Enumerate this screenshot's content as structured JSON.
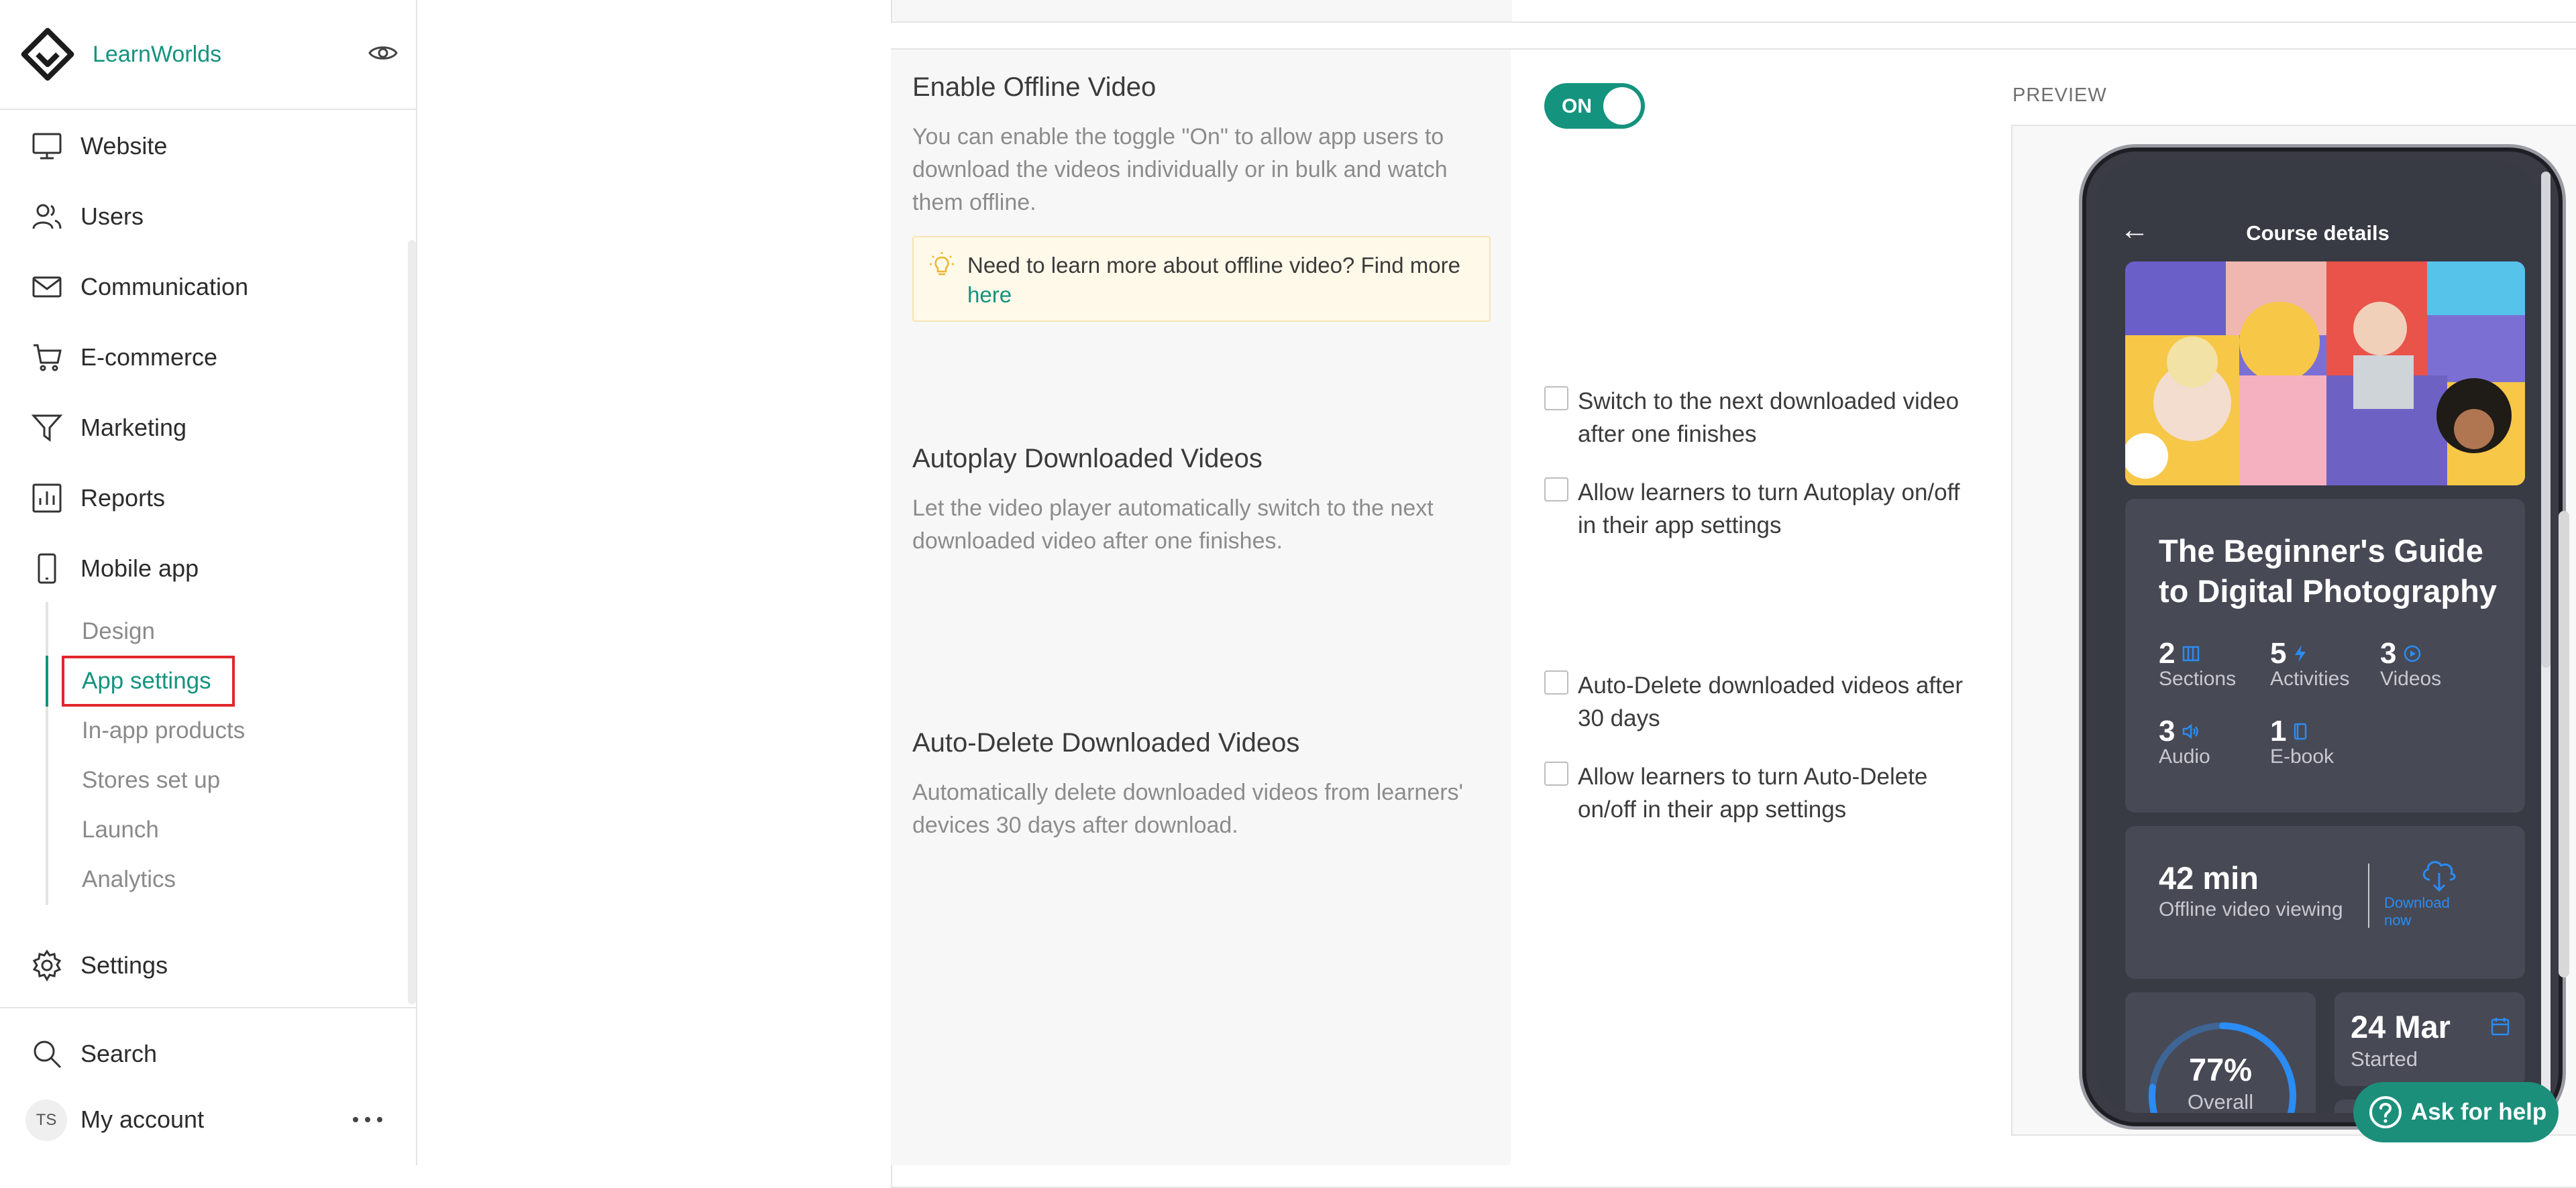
{
  "brand": {
    "name": "LearnWorlds"
  },
  "sidebar": {
    "items": [
      {
        "label": "Website",
        "icon": "monitor-icon"
      },
      {
        "label": "Users",
        "icon": "users-icon"
      },
      {
        "label": "Communication",
        "icon": "envelope-icon"
      },
      {
        "label": "E-commerce",
        "icon": "cart-icon"
      },
      {
        "label": "Marketing",
        "icon": "funnel-icon"
      },
      {
        "label": "Reports",
        "icon": "bar-chart-icon"
      },
      {
        "label": "Mobile app",
        "icon": "smartphone-icon"
      }
    ],
    "mobile_sub": [
      {
        "label": "Design"
      },
      {
        "label": "App settings",
        "active": true
      },
      {
        "label": "In-app products"
      },
      {
        "label": "Stores set up"
      },
      {
        "label": "Launch"
      },
      {
        "label": "Analytics"
      }
    ],
    "settings": "Settings",
    "search": "Search",
    "account": {
      "initials": "TS",
      "label": "My account"
    }
  },
  "offline": {
    "title": "Enable Offline Video",
    "description": "You can enable the toggle \"On\" to allow app users to download the videos individually or in bulk and watch them offline.",
    "tip": "Need to learn more about offline video? Find more",
    "tip_link": "here",
    "toggle_label": "ON",
    "toggle_on": true
  },
  "autoplay": {
    "title": "Autoplay Downloaded Videos",
    "description": "Let the video player automatically switch to the next downloaded video after one finishes.",
    "options": [
      {
        "label": "Switch to the next downloaded video after one finishes",
        "checked": false
      },
      {
        "label": "Allow learners to turn Autoplay on/off in their app settings",
        "checked": false
      }
    ]
  },
  "autodelete": {
    "title": "Auto-Delete Downloaded Videos",
    "description": "Automatically delete downloaded videos from learners' devices 30 days after download.",
    "options": [
      {
        "label": "Auto-Delete downloaded videos after 30 days",
        "checked": false
      },
      {
        "label": "Allow learners to turn Auto-Delete on/off in their app settings",
        "checked": false
      }
    ]
  },
  "preview": {
    "label": "PREVIEW",
    "phone": {
      "header": "Course details",
      "course_title": "The Beginner's Guide to Digital Photography",
      "stats": [
        {
          "num": "2",
          "label": "Sections",
          "icon": "columns-icon"
        },
        {
          "num": "5",
          "label": "Activities",
          "icon": "bolt-icon"
        },
        {
          "num": "3",
          "label": "Videos",
          "icon": "play-circle-icon"
        },
        {
          "num": "3",
          "label": "Audio",
          "icon": "speaker-icon"
        },
        {
          "num": "1",
          "label": "E-book",
          "icon": "book-icon"
        }
      ],
      "offline_minutes": "42 min",
      "offline_label": "Offline video viewing",
      "download_label": "Download now",
      "progress_label": "77%",
      "progress_value": 0.77,
      "overall_label": "Overall",
      "start_date": "24 Mar",
      "started_label": "Started"
    }
  },
  "help": {
    "label": "Ask for help"
  },
  "colors": {
    "accent": "#14937e",
    "highlight": "#e0262b",
    "phone_link": "#2a8cf4"
  }
}
